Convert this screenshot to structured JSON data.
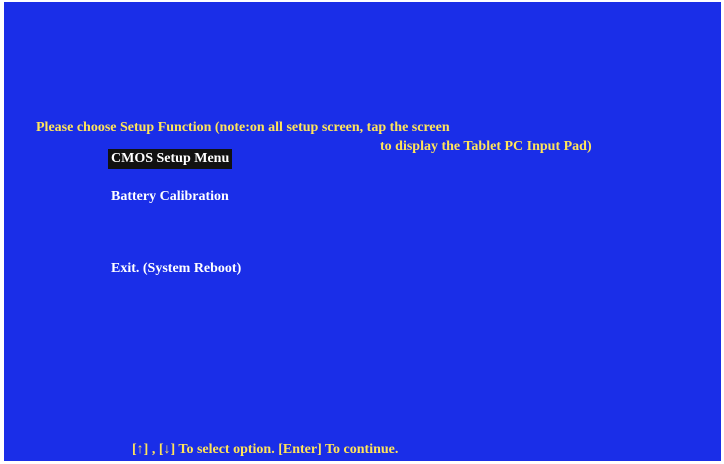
{
  "colors": {
    "background": "#1a2ee8",
    "prompt_text": "#ffe45a",
    "menu_text": "#ffffff",
    "selected_bg": "#111111"
  },
  "prompt": {
    "line1": "Please choose Setup Function (note:on all setup screen, tap the screen",
    "line2": "to display the Tablet PC Input Pad)"
  },
  "menu": {
    "items": [
      {
        "label": "CMOS Setup Menu",
        "selected": true
      },
      {
        "label": "Battery Calibration",
        "selected": false
      },
      {
        "label": "Exit. (System Reboot)",
        "selected": false
      }
    ]
  },
  "footer": {
    "text": "[↑] , [↓] To select option.  [Enter] To continue."
  }
}
